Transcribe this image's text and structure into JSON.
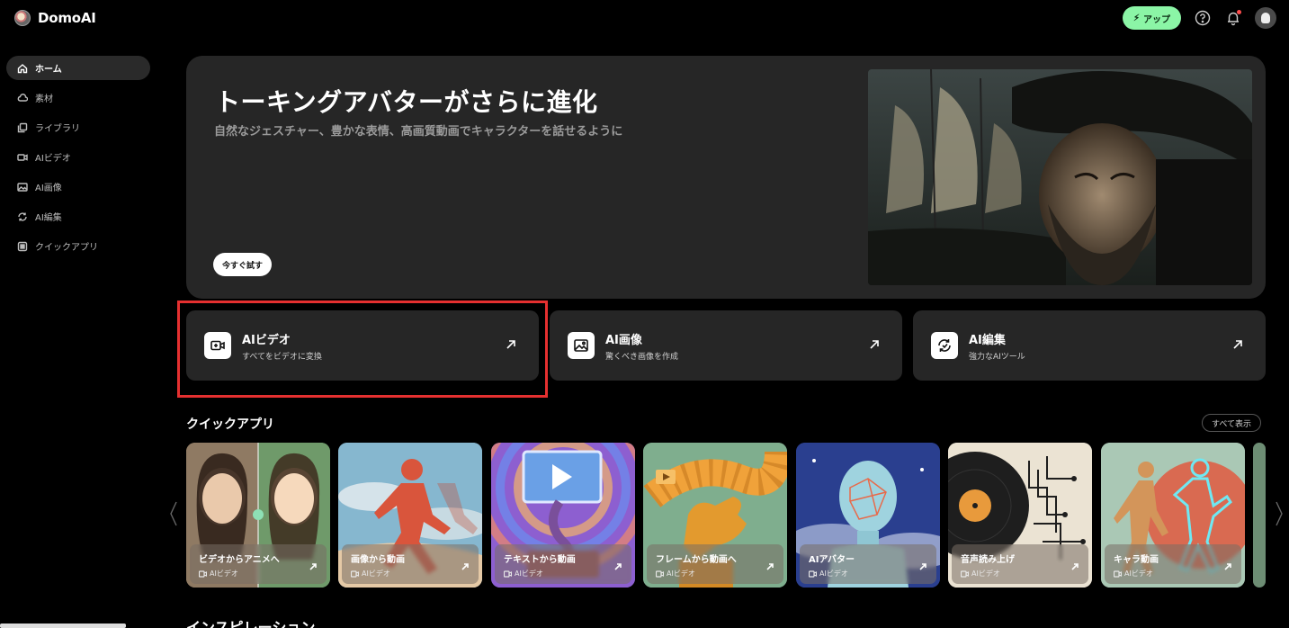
{
  "app": {
    "name": "DomoAI"
  },
  "sidebar": {
    "items": [
      {
        "label": "ホーム",
        "icon": "home-icon",
        "active": true
      },
      {
        "label": "素材",
        "icon": "cloud-icon"
      },
      {
        "label": "ライブラリ",
        "icon": "library-icon"
      },
      {
        "label": "AIビデオ",
        "icon": "video-icon"
      },
      {
        "label": "AI画像",
        "icon": "image-icon"
      },
      {
        "label": "AI編集",
        "icon": "edit-icon"
      },
      {
        "label": "クイックアプリ",
        "icon": "apps-icon"
      }
    ]
  },
  "header": {
    "upgrade_label": "アップ",
    "upgrade_color": "#8bf5a6"
  },
  "hero": {
    "title": "トーキングアバターがさらに進化",
    "subtitle": "自然なジェスチャー、豊かな表情、高画質動画でキャラクターを話せるように",
    "cta": "今すぐ試す"
  },
  "features": [
    {
      "title": "AIビデオ",
      "subtitle": "すべてをビデオに変換",
      "icon": "video-icon"
    },
    {
      "title": "AI画像",
      "subtitle": "驚くべき画像を作成",
      "icon": "image-icon"
    },
    {
      "title": "AI編集",
      "subtitle": "強力なAIツール",
      "icon": "edit-icon"
    }
  ],
  "quick_apps": {
    "heading": "クイックアプリ",
    "see_all": "すべて表示",
    "cards": [
      {
        "title": "ビデオからアニメへ",
        "tag": "AIビデオ"
      },
      {
        "title": "画像から動画",
        "tag": "AIビデオ"
      },
      {
        "title": "テキストから動画",
        "tag": "AIビデオ"
      },
      {
        "title": "フレームから動画へ",
        "tag": "AIビデオ"
      },
      {
        "title": "AIアバター",
        "tag": "AIビデオ"
      },
      {
        "title": "音声読み上げ",
        "tag": "AIビデオ"
      },
      {
        "title": "キャラ動画",
        "tag": "AIビデオ"
      }
    ]
  },
  "inspiration": {
    "heading": "インスピレーション"
  },
  "accent": {
    "highlight": "#e53030"
  }
}
